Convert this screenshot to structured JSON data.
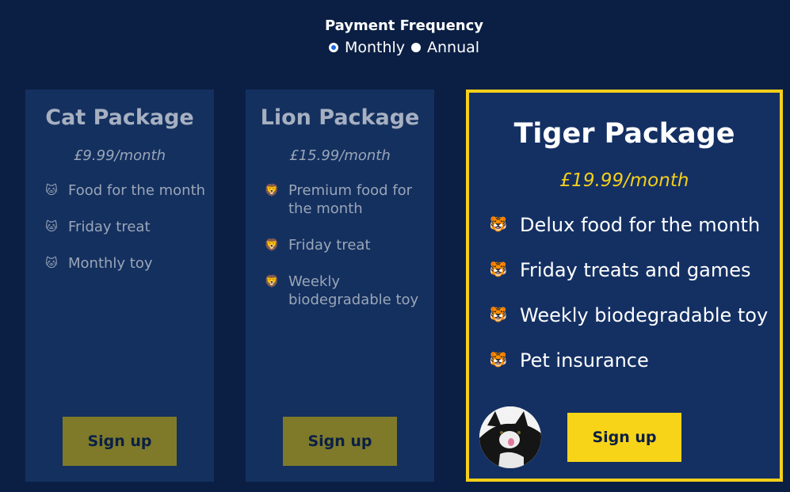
{
  "frequency": {
    "title": "Payment Frequency",
    "options": [
      {
        "label": "Monthly",
        "selected": true
      },
      {
        "label": "Annual",
        "selected": false
      }
    ]
  },
  "packages": [
    {
      "name": "Cat Package",
      "price": "£9.99/month",
      "icon": "cat-face-icon",
      "features": [
        "Food for the month",
        "Friday treat",
        "Monthly toy"
      ],
      "button": "Sign up"
    },
    {
      "name": "Lion Package",
      "price": "£15.99/month",
      "icon": "lion-face-icon",
      "features": [
        "Premium food for the month",
        "Friday treat",
        "Weekly biodegradable toy"
      ],
      "button": "Sign up"
    },
    {
      "name": "Tiger Package",
      "price": "£19.99/month",
      "icon": "tiger-face-icon",
      "features": [
        "Delux food for the month",
        "Friday treats and games",
        "Weekly biodegradable toy",
        "Pet insurance"
      ],
      "button": "Sign up"
    }
  ],
  "colors": {
    "background": "#0b1f44",
    "card": "#14305f",
    "accent": "#f5cf1a",
    "muted_button": "#7e7a2a"
  }
}
